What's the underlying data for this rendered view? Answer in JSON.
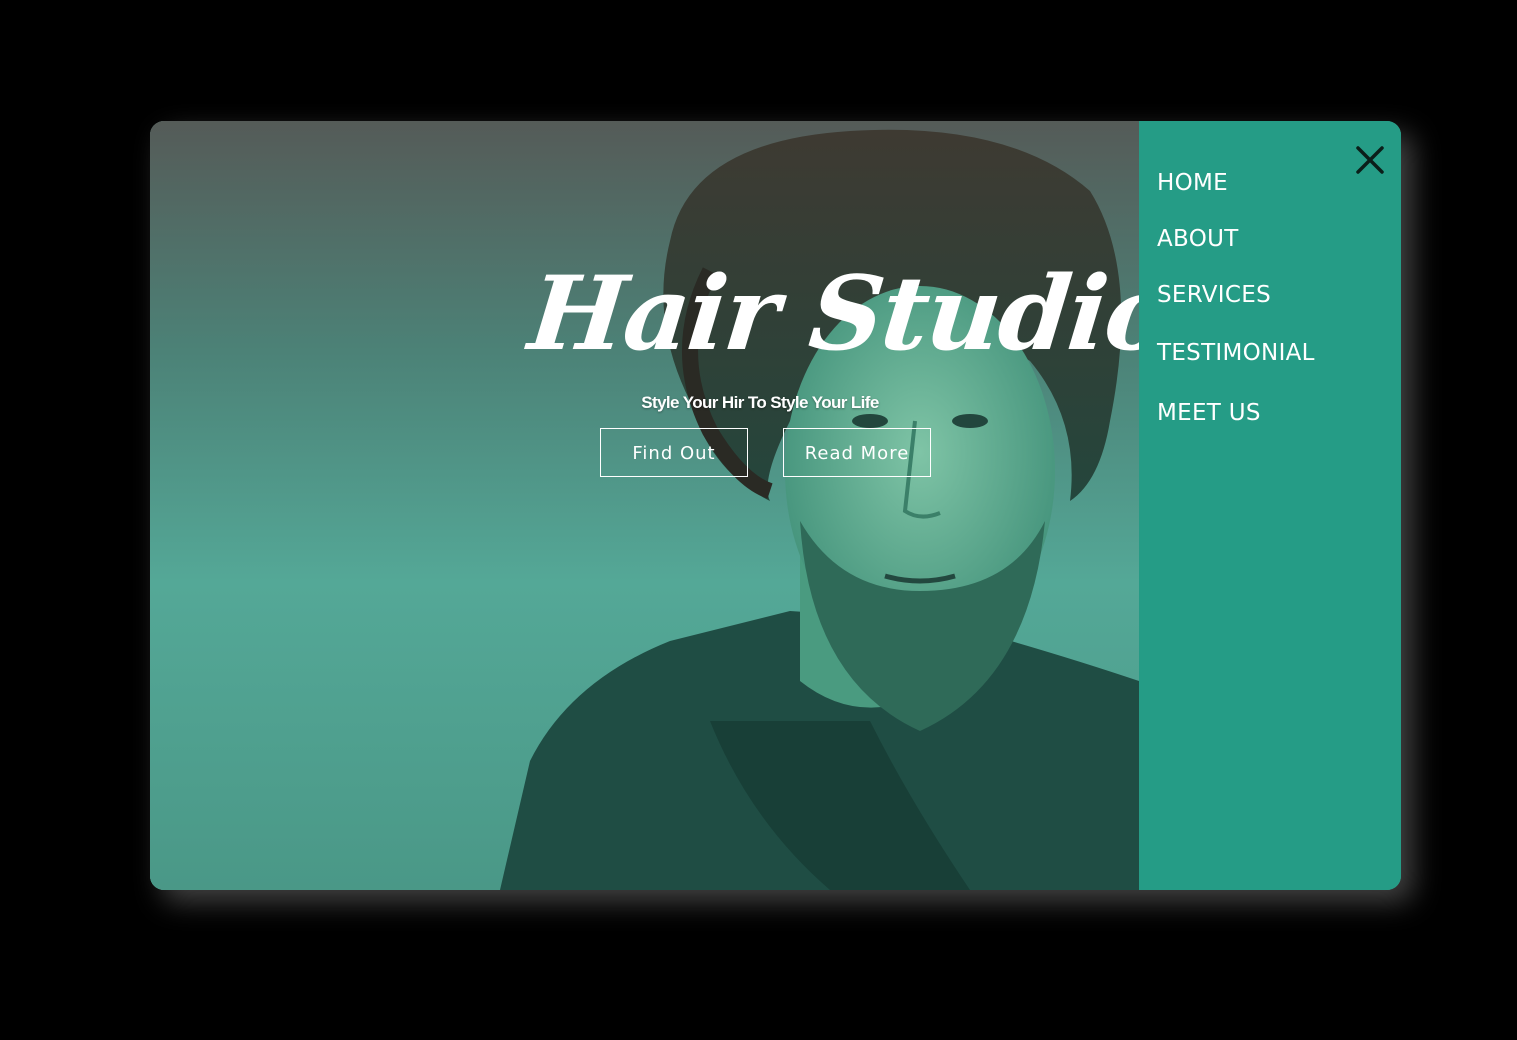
{
  "hero": {
    "title": "Hair Studio",
    "tagline": "Style Your Hir To Style Your Life",
    "buttons": {
      "find_out": "Find Out",
      "read_more": "Read More"
    },
    "image": "bearded-man-portrait"
  },
  "menu": {
    "close_icon": "close-icon",
    "items": [
      {
        "label": "HOME"
      },
      {
        "label": "ABOUT"
      },
      {
        "label": "SERVICES"
      },
      {
        "label": "TESTIMONIAL"
      },
      {
        "label": "MEET US"
      }
    ]
  },
  "colors": {
    "page_background": "#000000",
    "menu_background": "#259c86",
    "hero_tint": "#4fa392",
    "text": "#ffffff",
    "close_icon": "#0b1f1a"
  }
}
